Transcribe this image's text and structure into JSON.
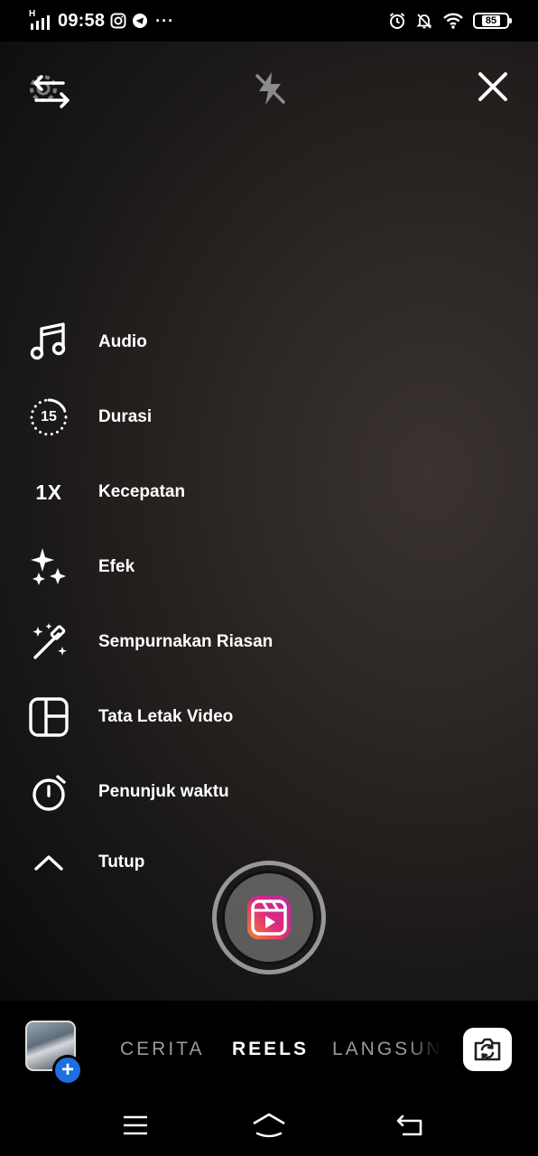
{
  "status_bar": {
    "signal_label": "H",
    "time": "09:58",
    "more": "···",
    "battery": "85",
    "icons": [
      "signal-icon",
      "instagram-icon",
      "telegram-icon",
      "alarm-icon",
      "bell-off-icon",
      "wifi-icon",
      "battery-icon"
    ]
  },
  "top_controls": {
    "icons": [
      "switch-camera-settings-icon",
      "flash-off-icon",
      "close-icon"
    ]
  },
  "menu": {
    "items": [
      {
        "label": "Audio",
        "icon": "music-note-icon"
      },
      {
        "label": "Durasi",
        "icon": "duration-icon",
        "icon_text": "15"
      },
      {
        "label": "Kecepatan",
        "icon": "speed-icon",
        "icon_text": "1X"
      },
      {
        "label": "Efek",
        "icon": "sparkles-icon"
      },
      {
        "label": "Sempurnakan Riasan",
        "icon": "magic-wand-icon"
      },
      {
        "label": "Tata Letak Video",
        "icon": "layout-icon"
      },
      {
        "label": "Penunjuk waktu",
        "icon": "timer-icon"
      },
      {
        "label": "Tutup",
        "icon": "chevron-up-icon"
      }
    ]
  },
  "shutter": {
    "icon": "reels-icon"
  },
  "modes": {
    "items": [
      "CERITA",
      "REELS",
      "LANGSUNG"
    ],
    "selected": "REELS"
  },
  "gallery": {
    "plus": "+"
  },
  "colors": {
    "accent_blue": "#1d6fe0",
    "reels_gradient_start": "#f58529",
    "reels_gradient_end": "#b32ba3"
  },
  "nav_bar": {
    "icons": [
      "menu-icon",
      "home-icon",
      "back-icon"
    ]
  }
}
